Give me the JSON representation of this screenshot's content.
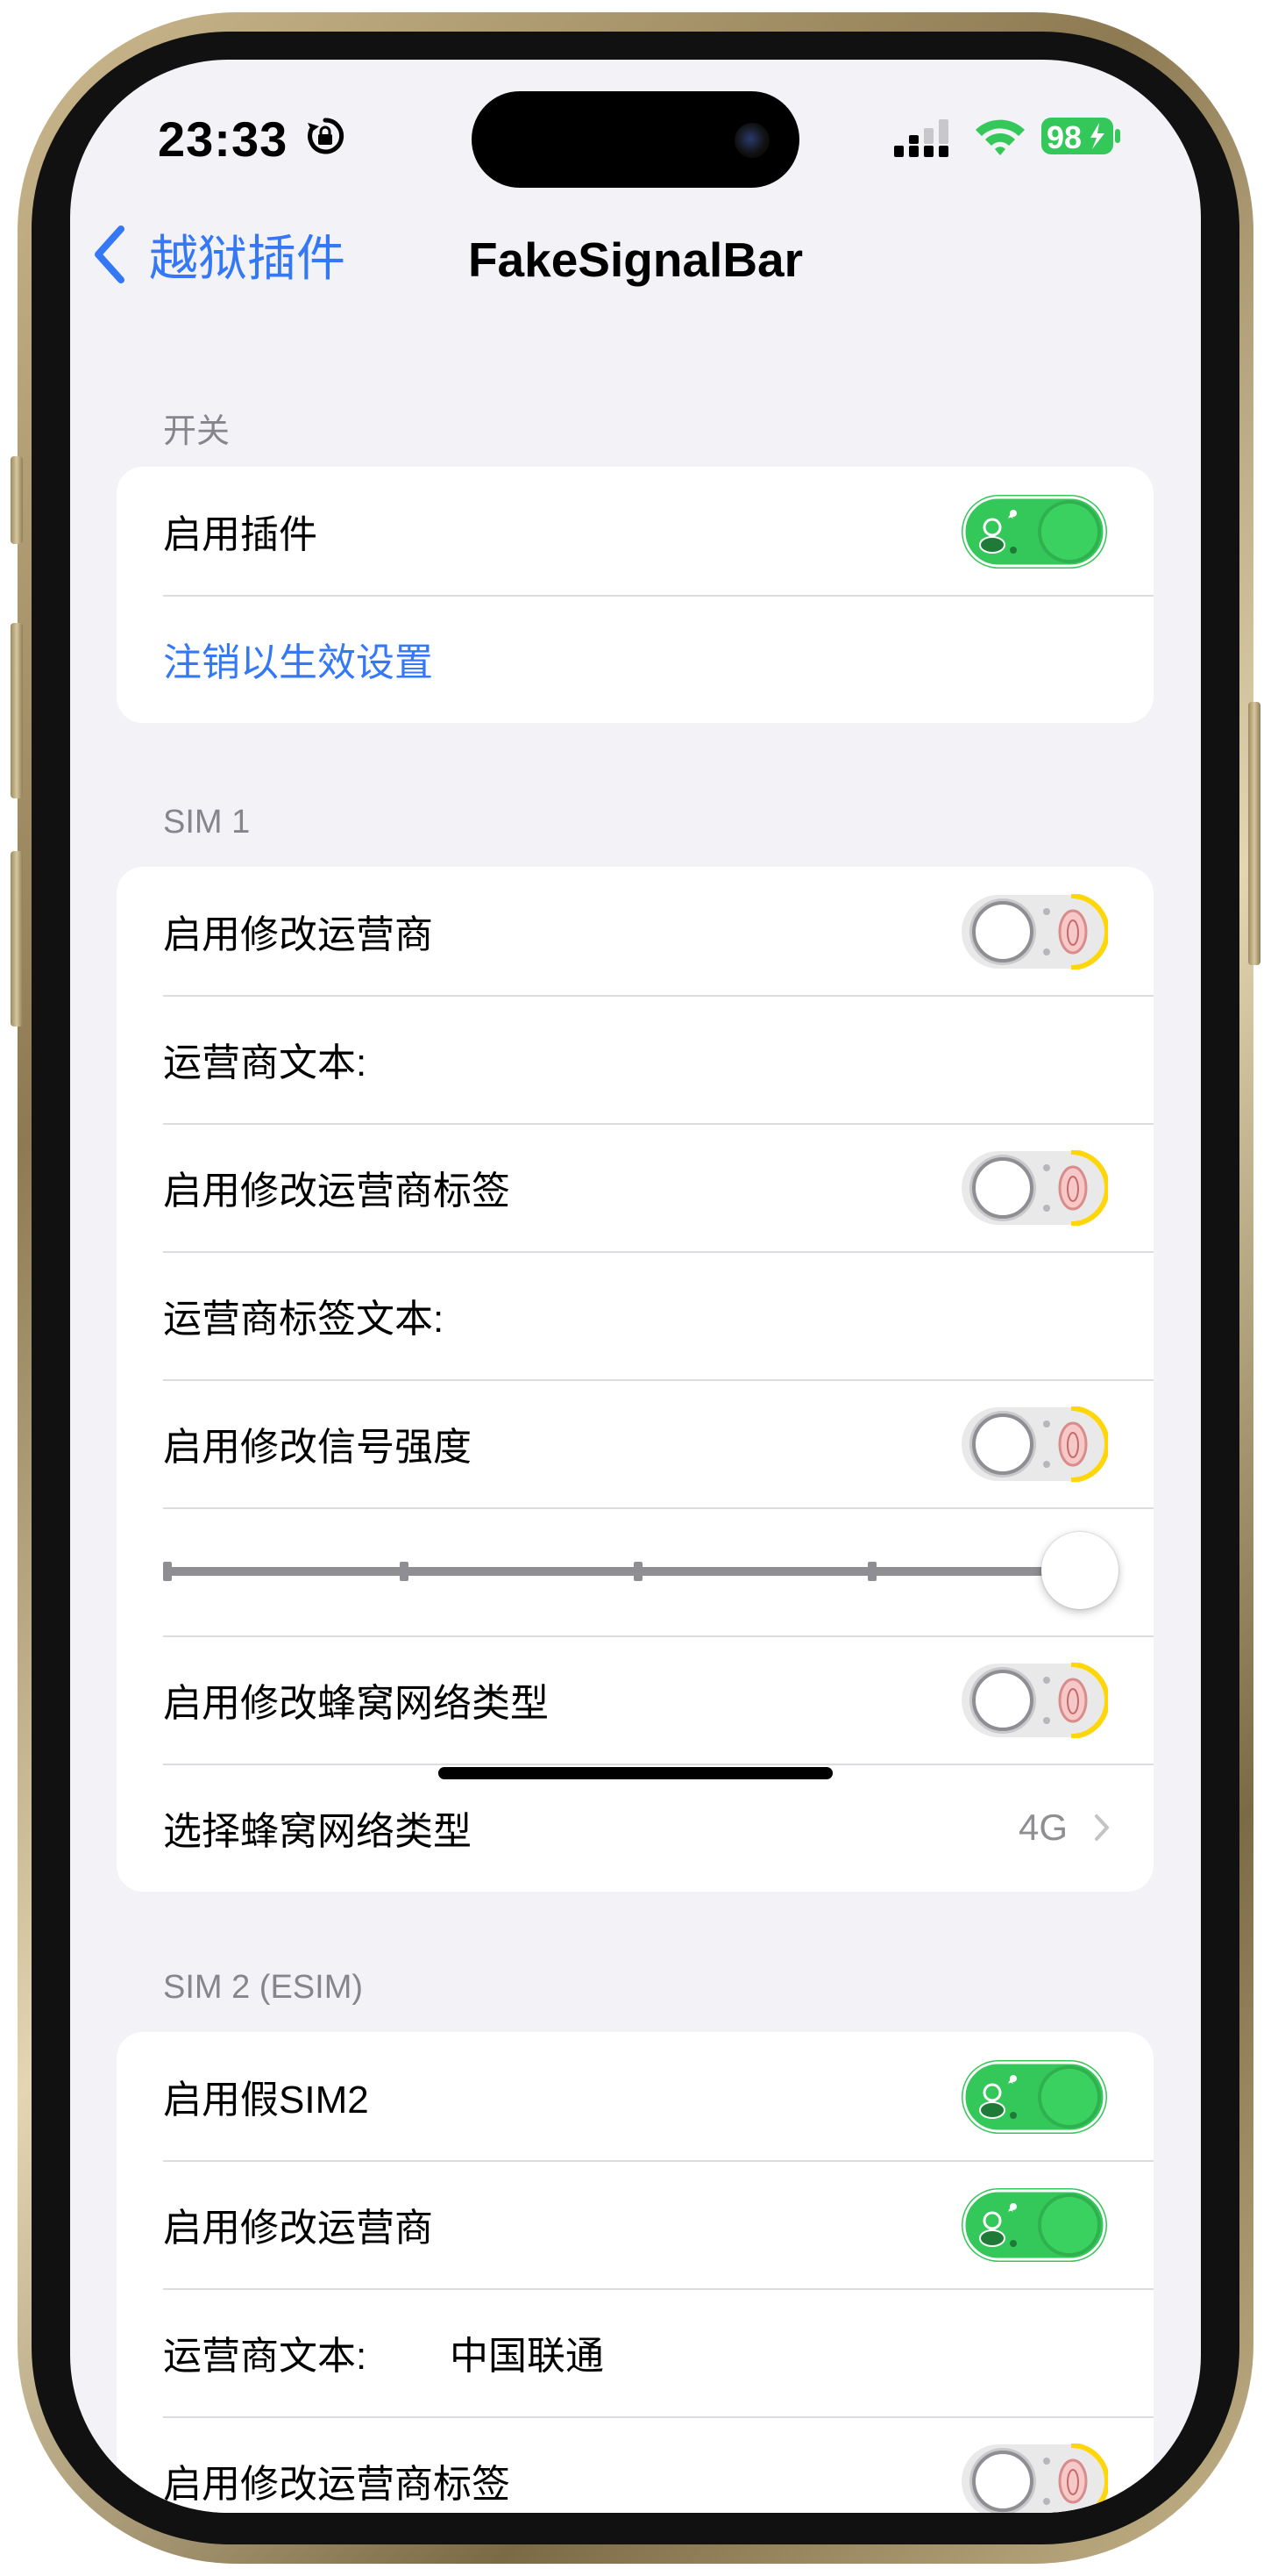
{
  "status_bar": {
    "time": "23:33",
    "battery": "98"
  },
  "nav": {
    "back_label": "越狱插件",
    "title": "FakeSignalBar"
  },
  "sections": {
    "switch": {
      "header": "开关",
      "enable_plugin": {
        "label": "启用插件",
        "on": true
      },
      "respring_label": "注销以生效设置"
    },
    "sim1": {
      "header": "SIM 1",
      "enable_carrier": {
        "label": "启用修改运营商",
        "on": false
      },
      "carrier_text_label": "运营商文本:",
      "enable_carrier_tag": {
        "label": "启用修改运营商标签",
        "on": false
      },
      "carrier_tag_text_label": "运营商标签文本:",
      "enable_signal": {
        "label": "启用修改信号强度",
        "on": false
      },
      "signal_level": 1.0,
      "enable_cell_type": {
        "label": "启用修改蜂窝网络类型",
        "on": false
      },
      "cell_type": {
        "label": "选择蜂窝网络类型",
        "value": "4G"
      }
    },
    "sim2": {
      "header": "SIM 2 (ESIM)",
      "enable_fake_sim2": {
        "label": "启用假SIM2",
        "on": true
      },
      "enable_carrier": {
        "label": "启用修改运营商",
        "on": true
      },
      "carrier_text": {
        "label": "运营商文本:",
        "value": "中国联通"
      },
      "enable_carrier_tag": {
        "label": "启用修改运营商标签",
        "on": false
      }
    }
  },
  "colors": {
    "accent": "#3478f6",
    "toggle_on": "#34c759",
    "toggle_off_accent": "#ffd60a",
    "background": "#f2f2f7"
  }
}
